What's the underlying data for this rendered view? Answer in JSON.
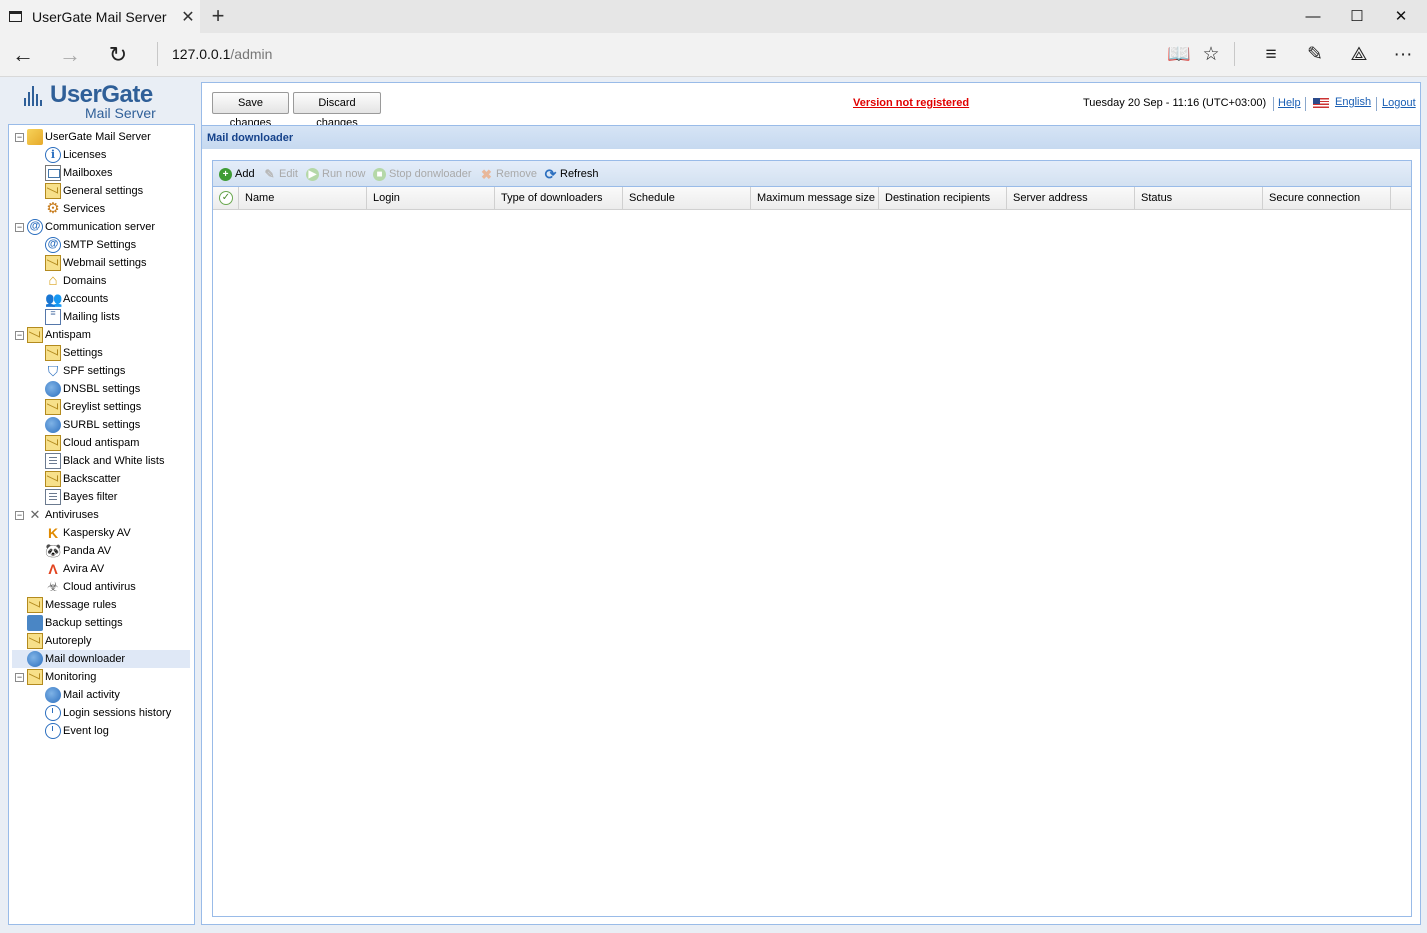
{
  "browser": {
    "tab_title": "UserGate Mail Server",
    "url_host": "127.0.0.1",
    "url_path": "/admin"
  },
  "logo": {
    "title": "UserGate",
    "subtitle": "Mail Server"
  },
  "tree": [
    {
      "label": "UserGate Mail Server",
      "icon": "server-icon",
      "level": 0,
      "expanded": true
    },
    {
      "label": "Licenses",
      "icon": "info-icon",
      "level": 1
    },
    {
      "label": "Mailboxes",
      "icon": "mailbox-icon",
      "level": 1
    },
    {
      "label": "General settings",
      "icon": "settings-icon",
      "level": 1
    },
    {
      "label": "Services",
      "icon": "gear-icon",
      "level": 1
    },
    {
      "label": "Communication server",
      "icon": "at-icon",
      "level": 0,
      "expanded": true
    },
    {
      "label": "SMTP Settings",
      "icon": "at-icon",
      "level": 1
    },
    {
      "label": "Webmail settings",
      "icon": "envelope-icon",
      "level": 1
    },
    {
      "label": "Domains",
      "icon": "house-icon",
      "level": 1
    },
    {
      "label": "Accounts",
      "icon": "people-icon",
      "level": 1
    },
    {
      "label": "Mailing lists",
      "icon": "list-icon",
      "level": 1
    },
    {
      "label": "Antispam",
      "icon": "antispam-icon",
      "level": 0,
      "expanded": true
    },
    {
      "label": "Settings",
      "icon": "envelope-icon",
      "level": 1
    },
    {
      "label": "SPF settings",
      "icon": "shield-icon",
      "level": 1
    },
    {
      "label": "DNSBL settings",
      "icon": "globe-icon",
      "level": 1
    },
    {
      "label": "Greylist settings",
      "icon": "envelope-icon",
      "level": 1
    },
    {
      "label": "SURBL settings",
      "icon": "globe-icon",
      "level": 1
    },
    {
      "label": "Cloud antispam",
      "icon": "envelope-icon",
      "level": 1
    },
    {
      "label": "Black and White lists",
      "icon": "document-icon",
      "level": 1
    },
    {
      "label": "Backscatter",
      "icon": "envelope-icon",
      "level": 1
    },
    {
      "label": "Bayes filter",
      "icon": "document-icon",
      "level": 1
    },
    {
      "label": "Antiviruses",
      "icon": "antivirus-icon",
      "level": 0,
      "expanded": true
    },
    {
      "label": "Kaspersky AV",
      "icon": "kaspersky-icon",
      "level": 1
    },
    {
      "label": "Panda AV",
      "icon": "panda-icon",
      "level": 1
    },
    {
      "label": "Avira AV",
      "icon": "avira-icon",
      "level": 1
    },
    {
      "label": "Cloud antivirus",
      "icon": "biohazard-icon",
      "level": 1
    },
    {
      "label": "Message rules",
      "icon": "envelope-icon",
      "level": 0
    },
    {
      "label": "Backup settings",
      "icon": "backup-icon",
      "level": 0
    },
    {
      "label": "Autoreply",
      "icon": "envelope-icon",
      "level": 0
    },
    {
      "label": "Mail downloader",
      "icon": "globe-icon",
      "level": 0,
      "selected": true
    },
    {
      "label": "Monitoring",
      "icon": "monitoring-icon",
      "level": 0,
      "expanded": true
    },
    {
      "label": "Mail activity",
      "icon": "globe-icon",
      "level": 1
    },
    {
      "label": "Login sessions history",
      "icon": "clock-icon",
      "level": 1
    },
    {
      "label": "Event log",
      "icon": "clock-icon",
      "level": 1
    }
  ],
  "header": {
    "save_label": "Save changes",
    "discard_label": "Discard changes",
    "registration_text": "Version not registered",
    "datetime": "Tuesday 20 Sep - 11:16 (UTC+03:00)",
    "help_label": "Help",
    "language_label": "English",
    "logout_label": "Logout"
  },
  "panel": {
    "title": "Mail downloader"
  },
  "toolbar": {
    "add": "Add",
    "edit": "Edit",
    "run_now": "Run now",
    "stop": "Stop donwloader",
    "remove": "Remove",
    "refresh": "Refresh"
  },
  "columns": [
    "Name",
    "Login",
    "Type of downloaders",
    "Schedule",
    "Maximum message size",
    "Destination recipients",
    "Server address",
    "Status",
    "Secure connection"
  ],
  "colors": {
    "accent": "#15428b",
    "border": "#99bbe8",
    "warning": "#e00000",
    "link": "#1a5fb4"
  }
}
